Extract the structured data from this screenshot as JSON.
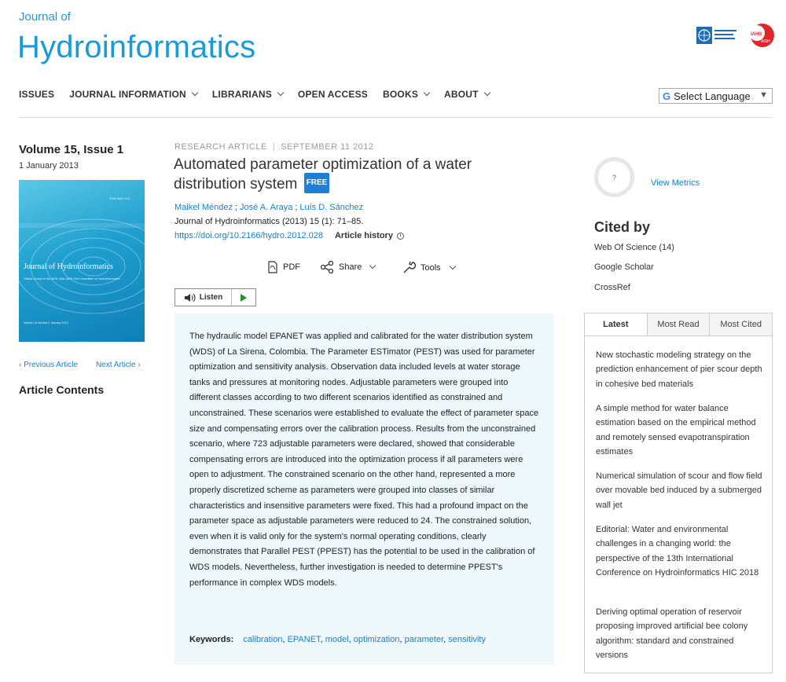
{
  "header": {
    "journal_of": "Journal of",
    "journal_name": "Hydroinformatics",
    "logo_iwa_text": "International Association for Hydro-Environment Engineering and Research",
    "logo_iahr_text": "IAHR AIPH"
  },
  "nav": {
    "items": [
      {
        "label": "ISSUES",
        "has_menu": false
      },
      {
        "label": "JOURNAL INFORMATION",
        "has_menu": true
      },
      {
        "label": "LIBRARIANS",
        "has_menu": true
      },
      {
        "label": "OPEN ACCESS",
        "has_menu": false
      },
      {
        "label": "BOOKS",
        "has_menu": true
      },
      {
        "label": "ABOUT",
        "has_menu": true
      }
    ],
    "language_select": "Select Language"
  },
  "issue": {
    "volume": "Volume 15, Issue 1",
    "date": "1 January 2013",
    "cover_title": "Journal of Hydroinformatics",
    "cover_subtitle": "Official Journal of the IAHR–IWA–IAHS Joint Committee on Hydroinformatics",
    "cover_issn": "ISSN 1464-7141",
    "cover_footer": "Volume 15 Number 1 January 2013",
    "previous_article": "Previous Article",
    "next_article": "Next Article",
    "article_contents": "Article Contents"
  },
  "article": {
    "type": "RESEARCH ARTICLE",
    "date": "SEPTEMBER 11 2012",
    "title": "Automated parameter optimization of a water distribution system",
    "free_badge": "FREE",
    "authors": [
      "Maikel Méndez",
      "José A. Araya",
      "Luís D. Sánchez"
    ],
    "citation": "Journal of Hydroinformatics (2013) 15 (1): 71–85.",
    "doi": "https://doi.org/10.2166/hydro.2012.028",
    "article_history": "Article history",
    "actions": {
      "pdf": "PDF",
      "share": "Share",
      "tools": "Tools"
    },
    "listen": "Listen",
    "abstract": "The hydraulic model EPANET was applied and calibrated for the water distribution system (WDS) of La Sirena, Colombia. The Parameter ESTimator (PEST) was used for parameter optimization and sensitivity analysis. Observation data included levels at water storage tanks and pressures at monitoring nodes. Adjustable parameters were grouped into different classes according to two different scenarios identified as constrained and unconstrained. These scenarios were established to evaluate the effect of parameter space size and compensating errors over the calibration process. Results from the unconstrained scenario, where 723 adjustable parameters were declared, showed that considerable compensating errors are introduced into the optimization process if all parameters were open to adjustment. The constrained scenario on the other hand, represented a more properly discretized scheme as parameters were grouped into classes of similar characteristics and insensitive parameters were fixed. This had a profound impact on the parameter space as adjustable parameters were reduced to 24. The constrained solution, even when it is valid only for the system's normal operating conditions, clearly demonstrates that Parallel PEST (PPEST) has the potential to be used in the calibration of WDS models. Nevertheless, further investigation is needed to determine PPEST's performance in complex WDS models.",
    "keywords_label": "Keywords:",
    "keywords": [
      "calibration",
      "EPANET",
      "model",
      "optimization",
      "parameter",
      "sensitivity"
    ]
  },
  "sidebar": {
    "metrics_placeholder": "?",
    "view_metrics": "View Metrics",
    "cited_by": "Cited by",
    "cite_links": [
      "Web Of Science (14)",
      "Google Scholar",
      "CrossRef"
    ],
    "tabs": [
      "Latest",
      "Most Read",
      "Most Cited"
    ],
    "active_tab": "Latest",
    "latest": [
      "New stochastic modeling strategy on the prediction enhancement of pier scour depth in cohesive bed materials",
      "A simple method for water balance estimation based on the empirical method and remotely sensed evapotranspiration estimates",
      "Numerical simulation of scour and flow field over movable bed induced by a submerged wall jet",
      "Editorial: Water and environmental challenges in a changing world: the perspective of the 13th International Conference on Hydroinformatics HIC 2018",
      "Deriving optimal operation of reservoir proposing improved artificial bee colony algorithm: standard and constrained versions"
    ]
  },
  "colors": {
    "brand": "#1a9bd7",
    "link": "#1a7fc3",
    "abstract_bg": "#eef7fa",
    "free_badge": "#1f7fd6"
  }
}
